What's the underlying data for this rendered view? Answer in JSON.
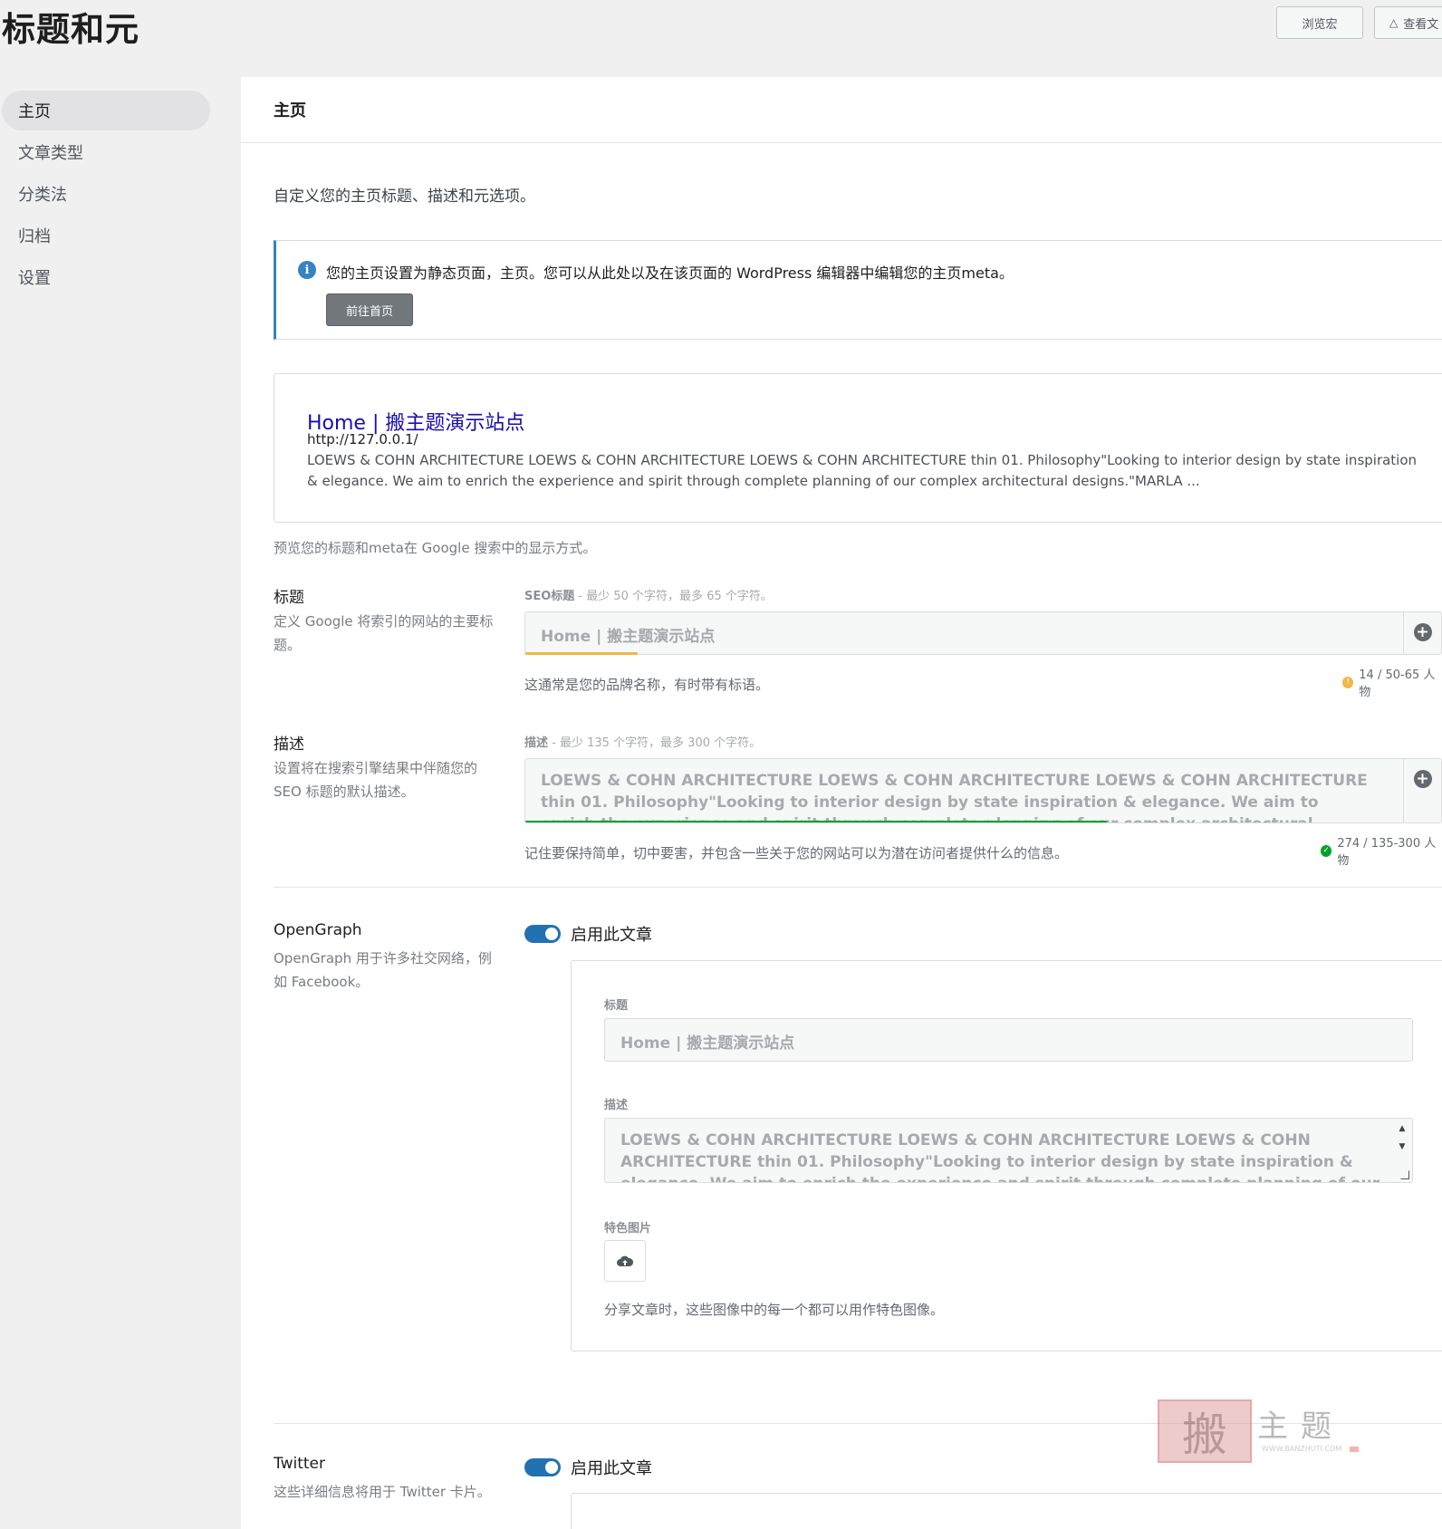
{
  "header": {
    "title": "标题和元",
    "browse_btn": "浏览宏",
    "view_btn": "查看文"
  },
  "sidebar": {
    "items": [
      {
        "label": "主页"
      },
      {
        "label": "文章类型"
      },
      {
        "label": "分类法"
      },
      {
        "label": "归档"
      },
      {
        "label": "设置"
      }
    ]
  },
  "panel": {
    "header": "主页",
    "intro": "自定义您的主页标题、描述和元选项。",
    "notice": {
      "text": "您的主页设置为静态页面，主页。您可以从此处以及在该页面的 WordPress 编辑器中编辑您的主页meta。",
      "button": "前往首页"
    },
    "google_preview": {
      "title": "Home | 搬主题演示站点",
      "url": "http://127.0.0.1/",
      "description": "LOEWS & COHN ARCHITECTURE LOEWS & COHN ARCHITECTURE LOEWS & COHN ARCHITECTURE thin 01. Philosophy\"Looking to interior design by state inspiration & elegance. We aim to enrich the experience and spirit through complete planning of our complex architectural designs.\"MARLA ...",
      "caption": "预览您的标题和meta在 Google 搜索中的显示方式。"
    },
    "title_row": {
      "label": "标题",
      "help": "定义 Google 将索引的网站的主要标题。",
      "field_caption_bold": "SEO标题",
      "field_caption": " - 最少 50 个字符，最多 65 个字符。",
      "value": "Home | 搬主题演示站点",
      "counter": "14 / 50-65 人物",
      "hint": "这通常是您的品牌名称，有时带有标语。"
    },
    "desc_row": {
      "label": "描述",
      "help": "设置将在搜索引擎结果中伴随您的 SEO 标题的默认描述。",
      "field_caption_bold": "描述",
      "field_caption": " - 最少 135 个字符，最多 300 个字符。",
      "value": "LOEWS & COHN ARCHITECTURE LOEWS & COHN ARCHITECTURE LOEWS & COHN ARCHITECTURE thin 01. Philosophy\"Looking to interior design by state inspiration & elegance. We aim to enrich the experience and spirit through complete planning of our complex architectural designs.\"MARLA",
      "counter": "274 / 135-300 人物",
      "hint": "记住要保持简单，切中要害，并包含一些关于您的网站可以为潜在访问者提供什么的信息。"
    },
    "opengraph": {
      "label": "OpenGraph",
      "help": "OpenGraph 用于许多社交网络，例如 Facebook。",
      "toggle_label": "启用此文章",
      "title_caption": "标题",
      "title_value": "Home | 搬主题演示站点",
      "desc_caption": "描述",
      "desc_value": "LOEWS & COHN ARCHITECTURE LOEWS & COHN ARCHITECTURE LOEWS & COHN ARCHITECTURE thin 01. Philosophy\"Looking to interior design by state inspiration & elegance. We aim to enrich the experience and spirit through complete planning of our complex architectural designs.\"MARLA",
      "image_caption": "特色图片",
      "image_hint": "分享文章时，这些图像中的每一个都可以用作特色图像。"
    },
    "twitter": {
      "label": "Twitter",
      "help": "这些详细信息将用于 Twitter 卡片。",
      "toggle_label": "启用此文章"
    }
  },
  "watermark": {
    "big": "搬",
    "text": "主题",
    "url": "WWW.BANZHUTI.COM"
  },
  "colors": {
    "accent": "#2271b1",
    "warn": "#f0b849",
    "ok": "#00a32a",
    "link": "#1a0dab"
  }
}
